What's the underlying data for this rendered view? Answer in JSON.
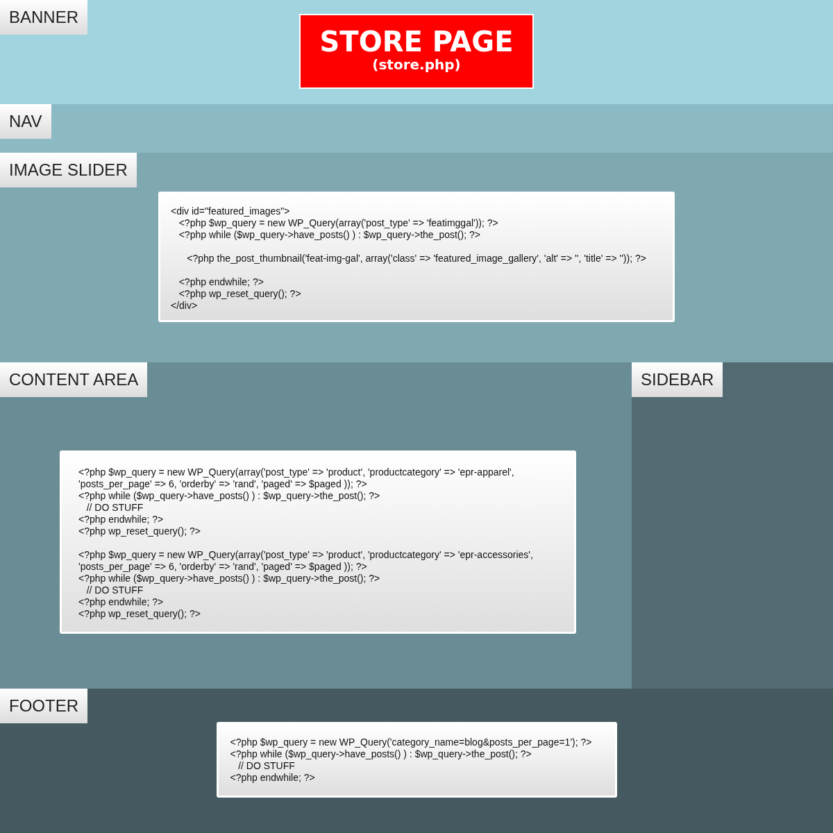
{
  "banner": {
    "label": "BANNER",
    "logo": {
      "title": "STORE PAGE",
      "subtitle": "(store.php)"
    }
  },
  "nav": {
    "label": "NAV"
  },
  "image_slider": {
    "label": "IMAGE SLIDER",
    "code": "<div id=\"featured_images\">\n   <?php $wp_query = new WP_Query(array('post_type' => 'featimggal')); ?>\n   <?php while ($wp_query->have_posts() ) : $wp_query->the_post(); ?>\n\n      <?php the_post_thumbnail('feat-img-gal', array('class' => 'featured_image_gallery', 'alt' => '', 'title' => '')); ?>\n\n   <?php endwhile; ?>\n   <?php wp_reset_query(); ?>\n</div>"
  },
  "content_area": {
    "label": "CONTENT AREA",
    "code": "<?php $wp_query = new WP_Query(array('post_type' => 'product', 'productcategory' => 'epr-apparel',\n'posts_per_page' => 6, 'orderby' => 'rand', 'paged' => $paged )); ?>\n<?php while ($wp_query->have_posts() ) : $wp_query->the_post(); ?>\n   // DO STUFF\n<?php endwhile; ?>\n<?php wp_reset_query(); ?>\n\n<?php $wp_query = new WP_Query(array('post_type' => 'product', 'productcategory' => 'epr-accessories',\n'posts_per_page' => 6, 'orderby' => 'rand', 'paged' => $paged )); ?>\n<?php while ($wp_query->have_posts() ) : $wp_query->the_post(); ?>\n   // DO STUFF\n<?php endwhile; ?>\n<?php wp_reset_query(); ?>"
  },
  "sidebar": {
    "label": "SIDEBAR"
  },
  "footer": {
    "label": "FOOTER",
    "code": "<?php $wp_query = new WP_Query('category_name=blog&posts_per_page=1'); ?>\n<?php while ($wp_query->have_posts() ) : $wp_query->the_post(); ?>\n   // DO STUFF\n<?php endwhile; ?>"
  }
}
